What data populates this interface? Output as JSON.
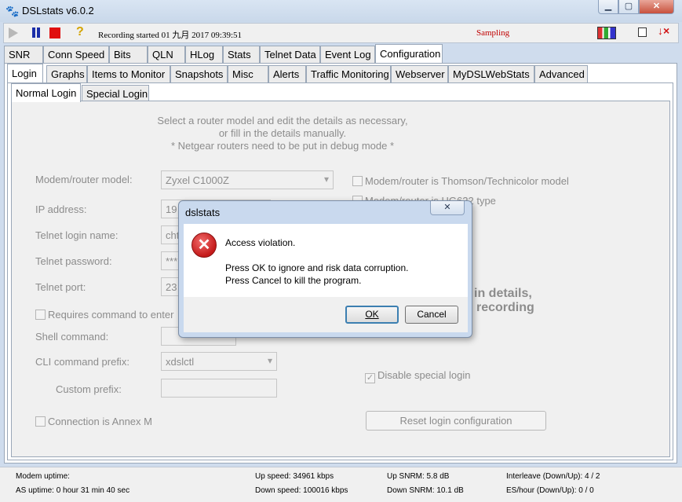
{
  "window": {
    "title": "DSLstats v6.0.2",
    "buttons": {
      "minimize": "▁",
      "maximize": "▢",
      "close": "✕"
    }
  },
  "toolbar": {
    "status": "Recording started 01 九月 2017 09:39:51",
    "sampling": "Sampling",
    "icons": [
      "play-icon",
      "pause-icon",
      "stop-icon",
      "help-icon",
      "chart-icon",
      "restore-icon",
      "download-x-icon"
    ],
    "help_glyph": "?",
    "exit_glyph": "↓×"
  },
  "main_tabs": [
    "SNR",
    "Conn Speed",
    "Bits",
    "QLN",
    "HLog",
    "Stats",
    "Telnet Data",
    "Event Log",
    "Configuration"
  ],
  "main_active": "Configuration",
  "sub_tabs": [
    "Login",
    "Graphs",
    "Items to Monitor",
    "Snapshots",
    "Misc",
    "Alerts",
    "Traffic Monitoring",
    "Webserver",
    "MyDSLWebStats",
    "Advanced"
  ],
  "sub_active": "Login",
  "inner_tabs": [
    "Normal Login",
    "Special Login"
  ],
  "inner_active": "Normal Login",
  "login": {
    "hint_lines": [
      "Select a router model and edit the details as necessary,",
      "or fill in the details manually.",
      "* Netgear routers need to be put in debug mode *"
    ],
    "model_label": "Modem/router model:",
    "model_value": "Zyxel C1000Z",
    "ip_label": "IP address:",
    "ip_value": "19",
    "telnet_name_label": "Telnet login name:",
    "telnet_name_value": "cht",
    "telnet_password_label": "Telnet password:",
    "telnet_password_value": "***",
    "telnet_port_label": "Telnet port:",
    "telnet_port_value": "23",
    "requires_cmd_label": "Requires command to enter",
    "shell_cmd_label": "Shell command:",
    "shell_cmd_value": "",
    "cli_prefix_label": "CLI command prefix:",
    "cli_prefix_value": "xdslctl",
    "custom_prefix_label": "Custom prefix:",
    "custom_prefix_value": "",
    "annex_m_label": "Connection is Annex M",
    "thomson_label": "Modem/router is Thomson/Technicolor model",
    "hg_label": "Modem/router is HG622 type",
    "notice_line1": "in details,",
    "notice_line2": "recording",
    "disable_special_label": "Disable special login",
    "reset_label": "Reset login configuration"
  },
  "statusbar": {
    "modem_uptime": "Modem uptime:",
    "as_uptime": "AS uptime:  0 hour 31 min 40 sec",
    "up_speed": "Up speed: 34961 kbps",
    "down_speed": "Down speed: 100016 kbps",
    "up_snrm": "Up SNRM: 5.8 dB",
    "down_snrm": "Down SNRM: 10.1 dB",
    "interleave": "Interleave (Down/Up): 4 / 2",
    "es_hour": "ES/hour (Down/Up): 0 / 0"
  },
  "dialog": {
    "title": "dslstats",
    "close": "✕",
    "error_glyph": "✕",
    "message": "Access violation.",
    "line2": "Press OK to ignore and risk data corruption.",
    "line3": "Press Cancel to kill the program.",
    "ok": "OK",
    "cancel": "Cancel"
  }
}
